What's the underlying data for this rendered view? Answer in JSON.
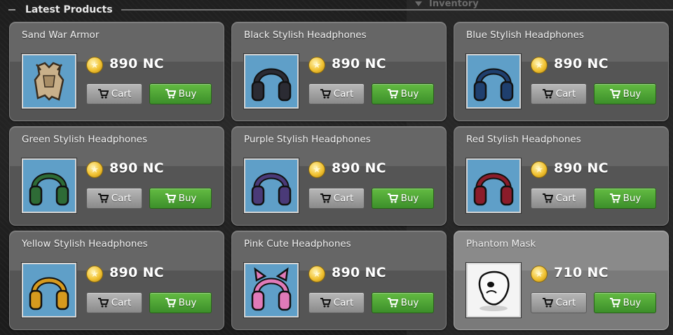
{
  "background": {
    "panel_title": "Inventory"
  },
  "section": {
    "title": "Latest Products"
  },
  "colors": {
    "buy_button": "#4aa335",
    "cart_button": "#a0a0a0",
    "thumbnail_bg": "#5f9fc8"
  },
  "products": [
    {
      "name": "Sand War Armor",
      "price": "890 NC",
      "cart_label": "Cart",
      "buy_label": "Buy",
      "icon": "sand-war-armor-icon",
      "color": "#c9b08a"
    },
    {
      "name": "Black Stylish Headphones",
      "price": "890 NC",
      "cart_label": "Cart",
      "buy_label": "Buy",
      "icon": "headphones-icon",
      "color": "#2b2b33"
    },
    {
      "name": "Blue Stylish Headphones",
      "price": "890 NC",
      "cart_label": "Cart",
      "buy_label": "Buy",
      "icon": "headphones-icon",
      "color": "#1f3f6e"
    },
    {
      "name": "Green Stylish Headphones",
      "price": "890 NC",
      "cart_label": "Cart",
      "buy_label": "Buy",
      "icon": "headphones-icon",
      "color": "#2e6b36"
    },
    {
      "name": "Purple Stylish Headphones",
      "price": "890 NC",
      "cart_label": "Cart",
      "buy_label": "Buy",
      "icon": "headphones-icon",
      "color": "#4a3a78"
    },
    {
      "name": "Red Stylish Headphones",
      "price": "890 NC",
      "cart_label": "Cart",
      "buy_label": "Buy",
      "icon": "headphones-icon",
      "color": "#8b1c2a"
    },
    {
      "name": "Yellow Stylish Headphones",
      "price": "890 NC",
      "cart_label": "Cart",
      "buy_label": "Buy",
      "icon": "headphones-icon",
      "color": "#d69a1e"
    },
    {
      "name": "Pink Cute Headphones",
      "price": "890 NC",
      "cart_label": "Cart",
      "buy_label": "Buy",
      "icon": "cat-ear-headphones-icon",
      "color": "#e07ab8"
    },
    {
      "name": "Phantom Mask",
      "price": "710 NC",
      "cart_label": "Cart",
      "buy_label": "Buy",
      "icon": "phantom-mask-icon",
      "color": "#ffffff"
    }
  ]
}
